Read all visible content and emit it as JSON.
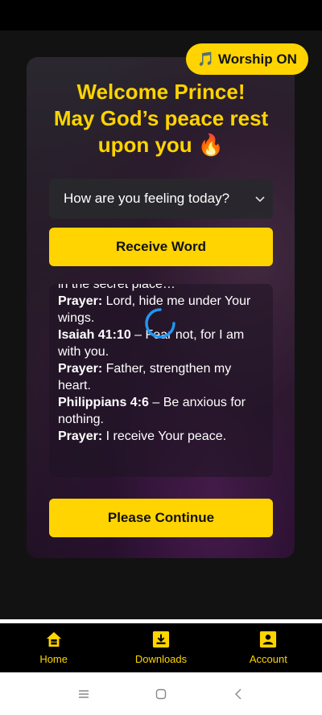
{
  "header": {
    "worship_toggle_label": "🎵 Worship ON"
  },
  "welcome": {
    "line1": "Welcome Prince!",
    "line2": "May God’s peace rest",
    "line3": "upon you 🔥"
  },
  "feeling": {
    "selected": "How are you feeling today?"
  },
  "buttons": {
    "receive_word": "Receive Word",
    "continue": "Please Continue"
  },
  "word": {
    "partial_top": "in the secret place…",
    "entries": [
      {
        "label": "Prayer:",
        "text": " Lord, hide me under Your wings."
      },
      {
        "label": "Isaiah 41:10",
        "text": " – Fear not, for I am with you."
      },
      {
        "label": "Prayer:",
        "text": " Father, strengthen my heart."
      },
      {
        "label": "Philippians 4:6",
        "text": " – Be anxious for nothing."
      },
      {
        "label": "Prayer:",
        "text": " I receive Your peace."
      }
    ]
  },
  "nav": [
    {
      "label": "Home",
      "icon": "home-icon"
    },
    {
      "label": "Downloads",
      "icon": "download-icon"
    },
    {
      "label": "Account",
      "icon": "account-icon"
    }
  ],
  "colors": {
    "accent": "#FFD400",
    "background": "#121212"
  }
}
